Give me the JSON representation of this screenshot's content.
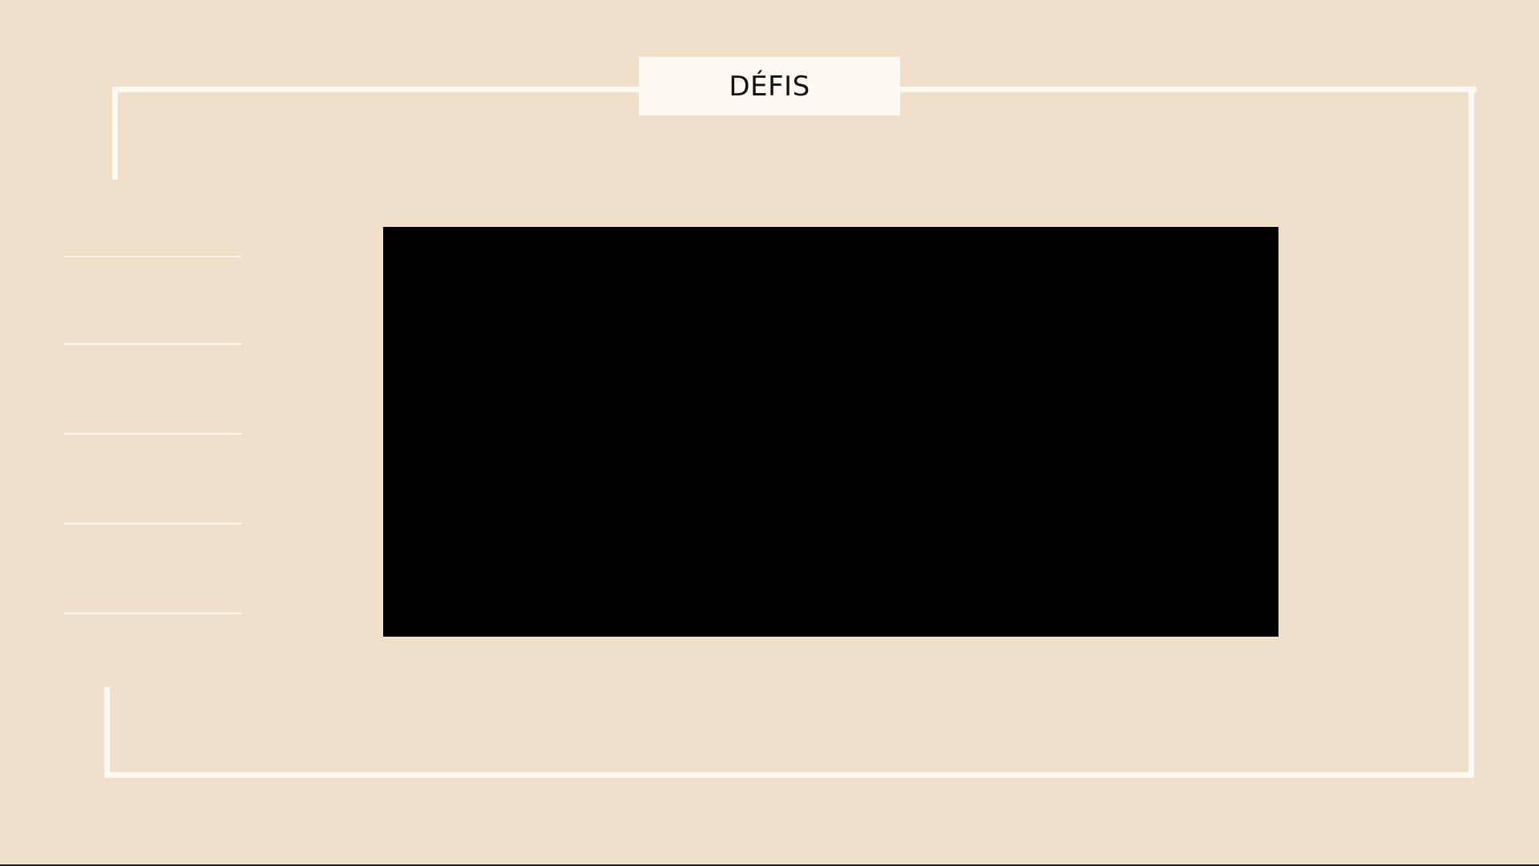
{
  "slide": {
    "title": "DÉFIS",
    "background_color": "#f0dfc9",
    "frame_color": "#fffaf1",
    "media_block_color": "#000000",
    "side_rule_count": 5
  }
}
